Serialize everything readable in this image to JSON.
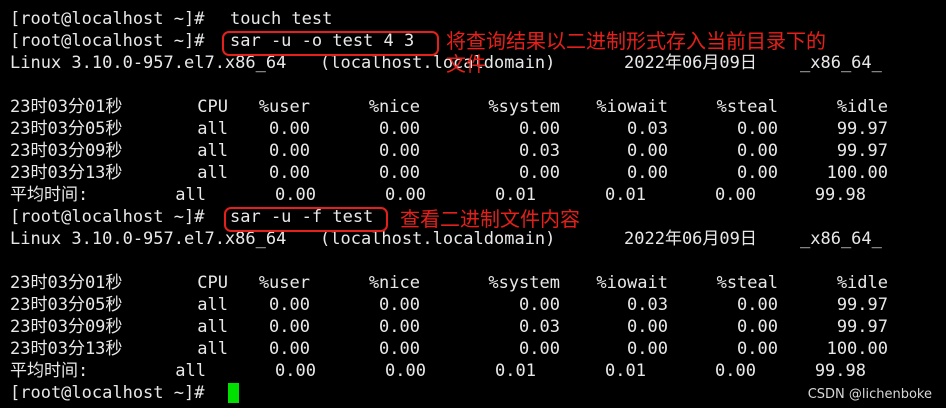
{
  "prompt": "[root@localhost ~]#",
  "commands": {
    "touch": "touch test",
    "sar_save": "sar -u -o test 4 3",
    "sar_read": "sar -u -f test"
  },
  "sysinfo": {
    "kernel": "Linux 3.10.0-957.el7.x86_64",
    "host": "(localhost.localdomain)",
    "date": "2022年06月09日",
    "arch": "_x86_64_"
  },
  "table": {
    "headers": [
      "CPU",
      "%user",
      "%nice",
      "%system",
      "%iowait",
      "%steal",
      "%idle"
    ],
    "rows": [
      [
        "23时03分01秒"
      ],
      [
        "23时03分05秒",
        "all",
        "0.00",
        "0.00",
        "0.00",
        "0.03",
        "0.00",
        "99.97"
      ],
      [
        "23时03分09秒",
        "all",
        "0.00",
        "0.00",
        "0.03",
        "0.00",
        "0.00",
        "99.97"
      ],
      [
        "23时03分13秒",
        "all",
        "0.00",
        "0.00",
        "0.00",
        "0.00",
        "0.00",
        "100.00"
      ]
    ],
    "average": [
      "平均时间:",
      "all",
      "0.00",
      "0.00",
      "0.01",
      "0.01",
      "0.00",
      "99.98"
    ]
  },
  "annotations": {
    "save": "将查询结果以二进制形式存入当前目录下的\n文件",
    "read": "查看二进制文件内容"
  },
  "watermark": "CSDN @lichenboke",
  "colors": {
    "annotation": "#e3201b",
    "cursor": "#00e000",
    "background": "#000000"
  }
}
